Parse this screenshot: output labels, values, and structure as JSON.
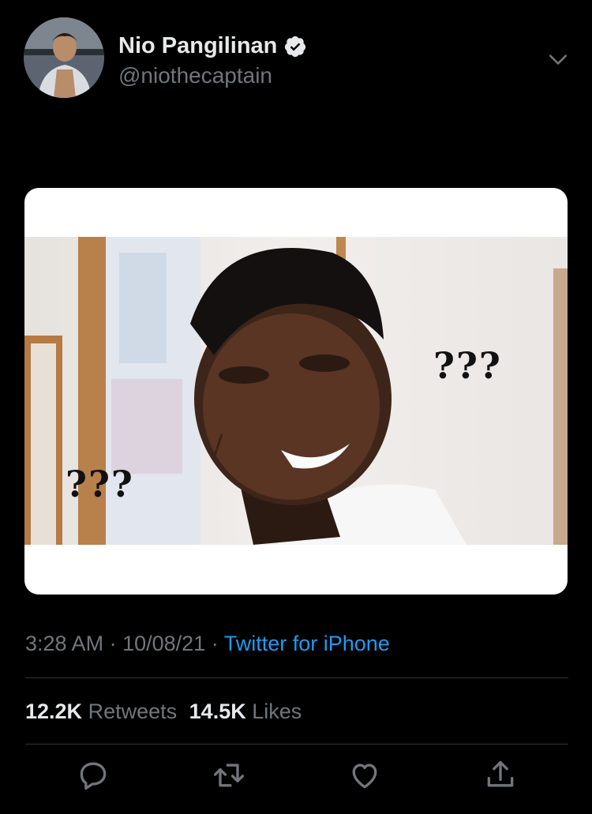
{
  "author": {
    "display_name": "Nio Pangilinan",
    "handle": "@niothecaptain",
    "verified_icon": "verified-badge-icon"
  },
  "tweet": {
    "media": {
      "overlay_left": "???",
      "overlay_right": "???"
    },
    "time": "3:28 AM",
    "separator": "·",
    "date": "10/08/21",
    "source": "Twitter for iPhone"
  },
  "stats": {
    "retweets_count": "12.2K",
    "retweets_label": "Retweets",
    "likes_count": "14.5K",
    "likes_label": "Likes"
  },
  "actions": [
    "reply-icon",
    "retweet-icon",
    "like-icon",
    "share-icon"
  ],
  "colors": {
    "background": "#000000",
    "text": "#e7e9ea",
    "secondary": "#71767b",
    "accent": "#1d9bf0",
    "divider": "#2f3336"
  }
}
